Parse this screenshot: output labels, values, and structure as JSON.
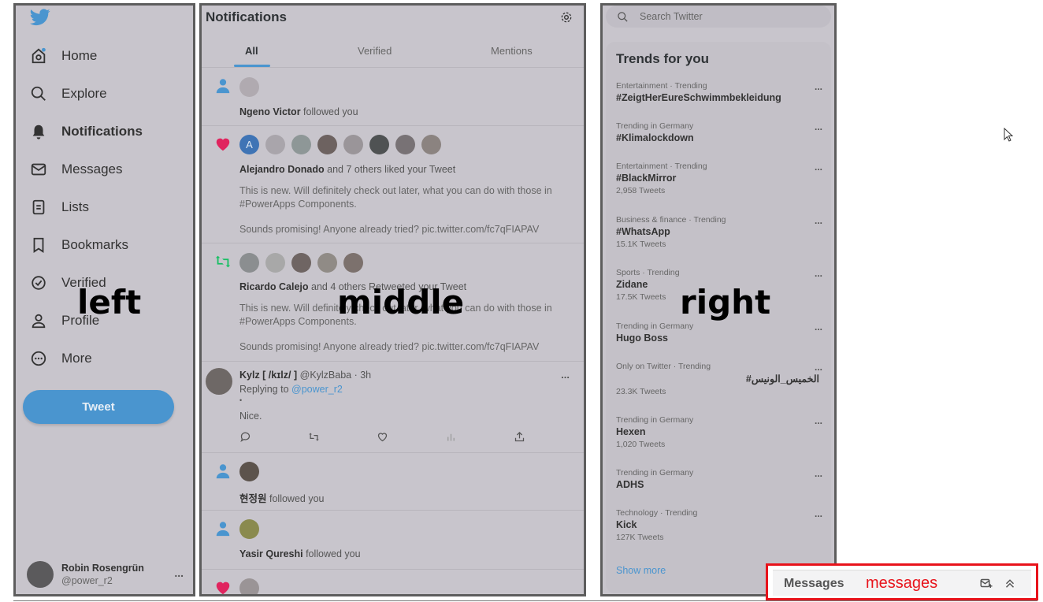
{
  "left": {
    "overlay_label": "left",
    "nav": [
      {
        "label": "Home",
        "icon": "home-icon"
      },
      {
        "label": "Explore",
        "icon": "search-icon"
      },
      {
        "label": "Notifications",
        "icon": "bell-icon"
      },
      {
        "label": "Messages",
        "icon": "envelope-icon"
      },
      {
        "label": "Lists",
        "icon": "list-icon"
      },
      {
        "label": "Bookmarks",
        "icon": "bookmark-icon"
      },
      {
        "label": "Verified",
        "icon": "verified-icon"
      },
      {
        "label": "Profile",
        "icon": "person-icon"
      },
      {
        "label": "More",
        "icon": "more-circle-icon"
      }
    ],
    "tweet_button": "Tweet",
    "account": {
      "name": "Robin Rosengrün",
      "handle": "@power_r2",
      "more": "..."
    }
  },
  "middle": {
    "overlay_label": "middle",
    "title": "Notifications",
    "tabs": [
      "All",
      "Verified",
      "Mentions"
    ],
    "notifications": [
      {
        "type": "follow",
        "actor": "Ngeno Victor",
        "text": " followed you"
      },
      {
        "type": "like",
        "actor": "Alejandro Donado",
        "text": " and 7 others liked your Tweet",
        "body1": "This is new. Will definitely check out later, what you can do with those in #PowerApps Components.",
        "body2": "Sounds promising! Anyone already tried? pic.twitter.com/fc7qFIAPAV",
        "first_avatar_letter": "A"
      },
      {
        "type": "retweet",
        "actor": "Ricardo Calejo",
        "text": " and 4 others Retweeted your Tweet",
        "body1": "This is new. Will definitely check out later, what you can do with those in #PowerApps Components.",
        "body2": "Sounds promising! Anyone already tried? pic.twitter.com/fc7qFIAPAV"
      },
      {
        "type": "reply",
        "name": "Kylz [ /kɪlz/ ]",
        "handle": "@KylzBaba · 3h",
        "replying_prefix": "Replying to ",
        "replying_to": "@power_r2",
        "dot": "•",
        "body": "Nice.",
        "more": "..."
      },
      {
        "type": "follow",
        "actor": "현정원",
        "text": " followed you"
      },
      {
        "type": "follow",
        "actor": "Yasir Qureshi",
        "text": " followed you"
      }
    ]
  },
  "right": {
    "overlay_label": "right",
    "search_placeholder": "Search Twitter",
    "trends_title": "Trends for you",
    "trends": [
      {
        "meta": "Entertainment · Trending",
        "name": "#ZeigtHerEureSchwimmbekleidung",
        "count": ""
      },
      {
        "meta": "Trending in Germany",
        "name": "#Klimalockdown",
        "count": ""
      },
      {
        "meta": "Entertainment · Trending",
        "name": "#BlackMirror",
        "count": "2,958 Tweets"
      },
      {
        "meta": "Business & finance · Trending",
        "name": "#WhatsApp",
        "count": "15.1K Tweets"
      },
      {
        "meta": "Sports · Trending",
        "name": "Zidane",
        "count": "17.5K Tweets"
      },
      {
        "meta": "Trending in Germany",
        "name": "Hugo Boss",
        "count": ""
      },
      {
        "meta": "Only on Twitter · Trending",
        "name": "#الخميس_الونيس",
        "count": "23.3K Tweets"
      },
      {
        "meta": "Trending in Germany",
        "name": "Hexen",
        "count": "1,020 Tweets"
      },
      {
        "meta": "Trending in Germany",
        "name": "ADHS",
        "count": ""
      },
      {
        "meta": "Technology · Trending",
        "name": "Kick",
        "count": "127K Tweets"
      }
    ],
    "more": "...",
    "show_more": "Show more"
  },
  "messages": {
    "title": "Messages",
    "overlay_label": "messages"
  },
  "colors": {
    "accent": "#4a95cf",
    "like": "#e0245e",
    "retweet": "#17bf63",
    "highlight": "#e8131b"
  }
}
